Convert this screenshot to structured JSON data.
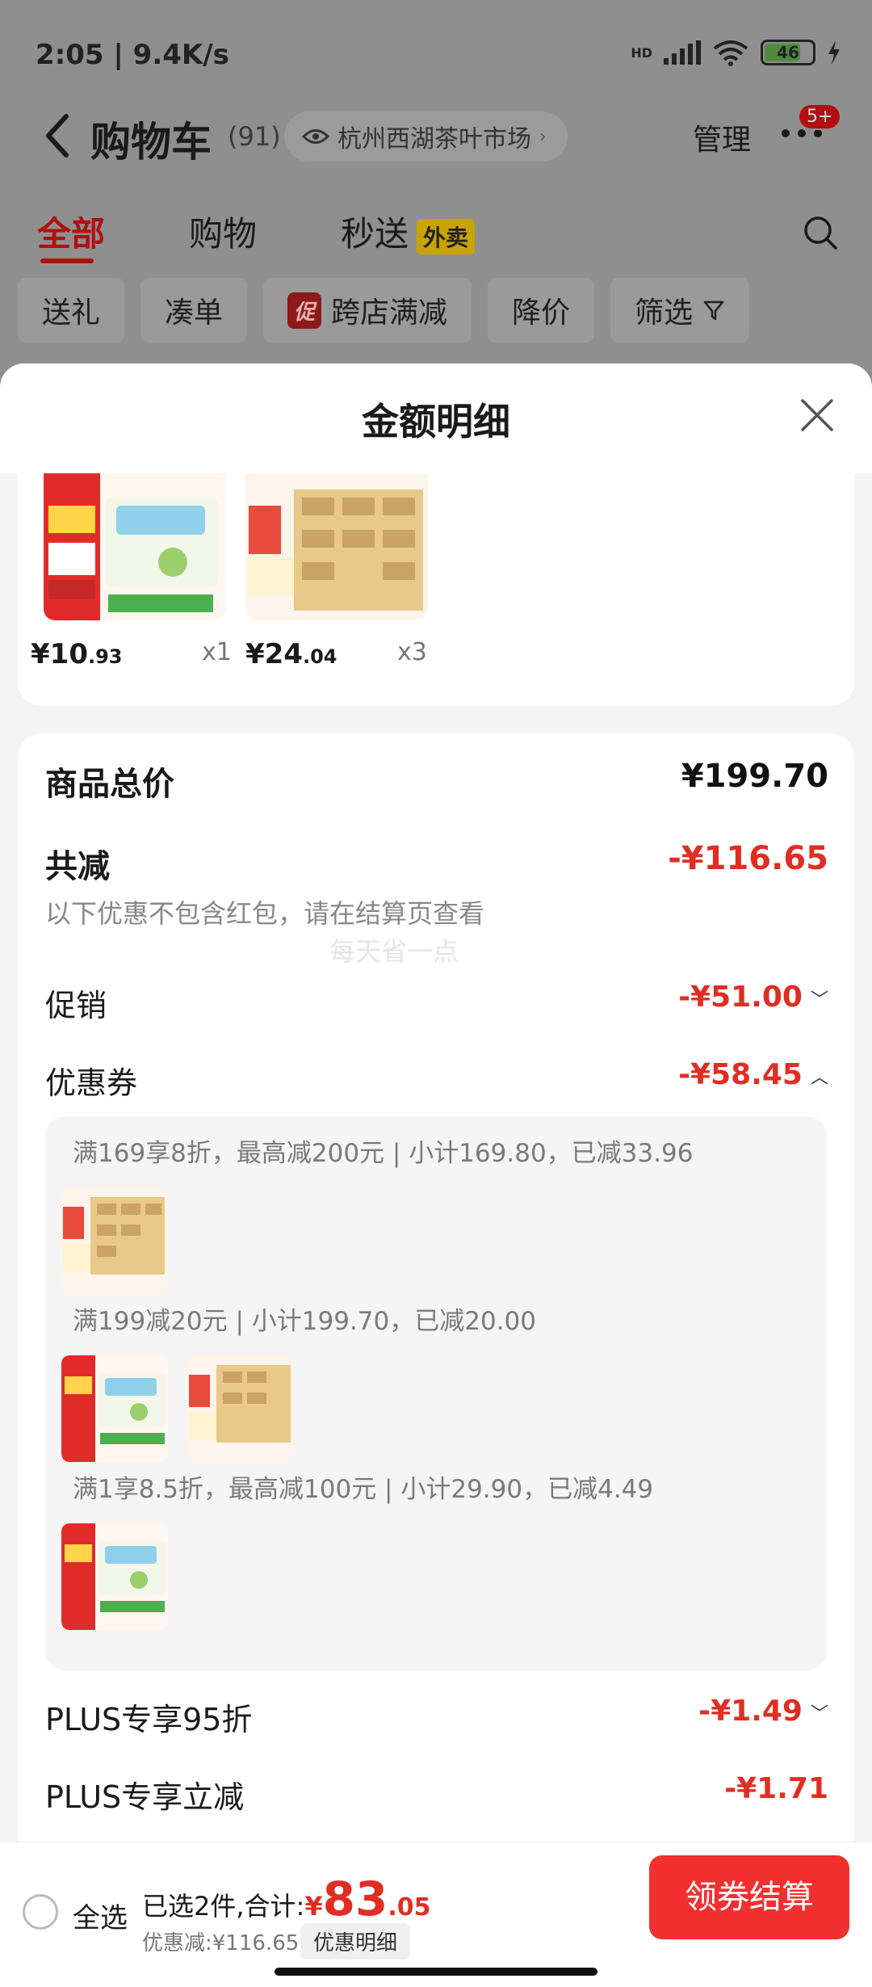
{
  "status": {
    "time": "2:05 | 9.4K/s",
    "battery": "46",
    "network": "HD"
  },
  "nav": {
    "title": "购物车",
    "count": "(91)",
    "location": "杭州西湖茶叶市场",
    "manage": "管理",
    "badge": "5+"
  },
  "tabs": [
    {
      "label": "全部"
    },
    {
      "label": "购物"
    },
    {
      "label": "秒送"
    }
  ],
  "tab_tag": "外卖",
  "chips": [
    {
      "label": "送礼"
    },
    {
      "label": "凑单"
    },
    {
      "label": "跨店满减"
    },
    {
      "label": "降价"
    },
    {
      "label": "筛选"
    }
  ],
  "promo_tag": "促",
  "sheet": {
    "title": "金额明细"
  },
  "products": [
    {
      "price_int": "¥10",
      "price_dec": ".93",
      "qty": "x1"
    },
    {
      "price_int": "¥24",
      "price_dec": ".04",
      "qty": "x3"
    }
  ],
  "summary": {
    "total_label": "商品总价",
    "total_value": "¥199.70",
    "reduce_label": "共减",
    "reduce_value": "-¥116.65",
    "note": "以下优惠不包含红包，请在结算页查看",
    "watermark": "每天省一点",
    "promo_label": "促销",
    "promo_value": "-¥51.00",
    "coupon_label": "优惠券",
    "coupon_value": "-¥58.45",
    "plus95_label": "PLUS专享95折",
    "plus95_value": "-¥1.49",
    "plusreduce_label": "PLUS专享立减",
    "plusreduce_value": "-¥1.71"
  },
  "coupons": [
    {
      "text": "满169享8折，最高减200元 | 小计169.80，已减33.96"
    },
    {
      "text": "满199减20元 | 小计199.70，已减20.00"
    },
    {
      "text": "满1享8.5折，最高减100元 | 小计29.90，已减4.49"
    }
  ],
  "bottom": {
    "select_all": "全选",
    "selected_text": "已选2件,合计:",
    "currency": "¥",
    "total_int": "83",
    "total_dec": ".05",
    "discount_text": "优惠减:¥116.65",
    "detail_btn": "优惠明细",
    "checkout": "领券结算"
  },
  "colors": {
    "accent_red": "#e02e24",
    "checkout_red": "#f23030"
  }
}
